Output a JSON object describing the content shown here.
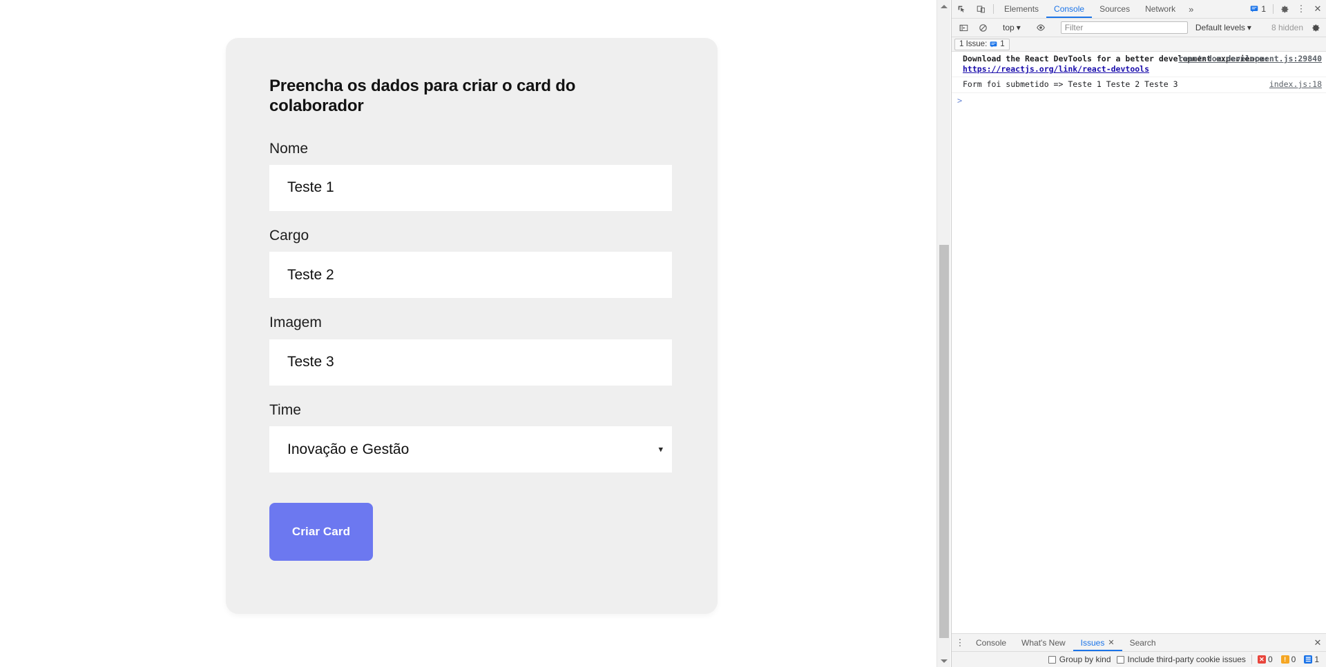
{
  "page": {
    "form": {
      "title": "Preencha os dados para criar o card do colaborador",
      "fields": [
        {
          "label": "Nome",
          "value": "Teste 1",
          "placeholder": "",
          "type": "text"
        },
        {
          "label": "Cargo",
          "value": "Teste 2",
          "placeholder": "",
          "type": "text"
        },
        {
          "label": "Imagem",
          "value": "Teste 3",
          "placeholder": "",
          "type": "text"
        }
      ],
      "select": {
        "label": "Time",
        "value": "Inovação e Gestão",
        "options": [
          "Inovação e Gestão"
        ],
        "caret": "chevron-down-icon"
      },
      "submit_label": "Criar Card",
      "submit_color": "#6c78f0",
      "card_bg": "#efefef"
    }
  },
  "scrollbar": {
    "up_arrow": "caret-up-icon",
    "down_arrow": "caret-down-icon"
  },
  "devtools": {
    "tabbar": {
      "inspect_icon": "inspect-element-icon",
      "device_icon": "device-toolbar-icon",
      "tabs": [
        {
          "label": "Elements",
          "active": false
        },
        {
          "label": "Console",
          "active": true
        },
        {
          "label": "Sources",
          "active": false
        },
        {
          "label": "Network",
          "active": false
        }
      ],
      "more_label": "»",
      "issue_badge_count": "1",
      "settings_icon": "gear-icon",
      "kebab_icon": "more-vertical-icon",
      "close_icon": "close-icon"
    },
    "toolbar": {
      "execute_icon": "console-sidebar-icon",
      "clear_icon": "clear-console-icon",
      "context": "top",
      "eye_icon": "live-expression-icon",
      "filter_placeholder": "Filter",
      "filter_value": "",
      "levels": "Default levels",
      "hidden": "8 hidden",
      "settings_icon": "gear-icon"
    },
    "issuebar": {
      "label": "1 Issue:",
      "badge_icon": "issue-info-icon",
      "count": "1"
    },
    "console": {
      "messages": [
        {
          "text": "Download the React DevTools for a better development experience: ",
          "link": "https://reactjs.org/link/react-devtools",
          "source": "react-dom.development.js:29840",
          "bold": true
        },
        {
          "text": "Form foi submetido =>  Teste 1 Teste 2 Teste 3",
          "link": "",
          "source": "index.js:18",
          "bold": false
        }
      ],
      "prompt": ">"
    },
    "drawer": {
      "kebab_icon": "more-vertical-icon",
      "tabs": [
        {
          "label": "Console",
          "active": false,
          "closable": false
        },
        {
          "label": "What's New",
          "active": false,
          "closable": false
        },
        {
          "label": "Issues",
          "active": true,
          "closable": true
        },
        {
          "label": "Search",
          "active": false,
          "closable": false
        }
      ],
      "close_icon": "close-icon",
      "close_x": "✕"
    },
    "issue_filters": {
      "group_by_kind": "Group by kind",
      "third_party": "Include third-party cookie issues",
      "counts": [
        {
          "kind": "error",
          "color": "#e8453c",
          "value": "0",
          "icon": "error-icon"
        },
        {
          "kind": "warning",
          "color": "#f5a623",
          "value": "0",
          "icon": "warning-icon"
        },
        {
          "kind": "info",
          "color": "#1a73e8",
          "value": "1",
          "icon": "info-icon"
        }
      ]
    }
  }
}
